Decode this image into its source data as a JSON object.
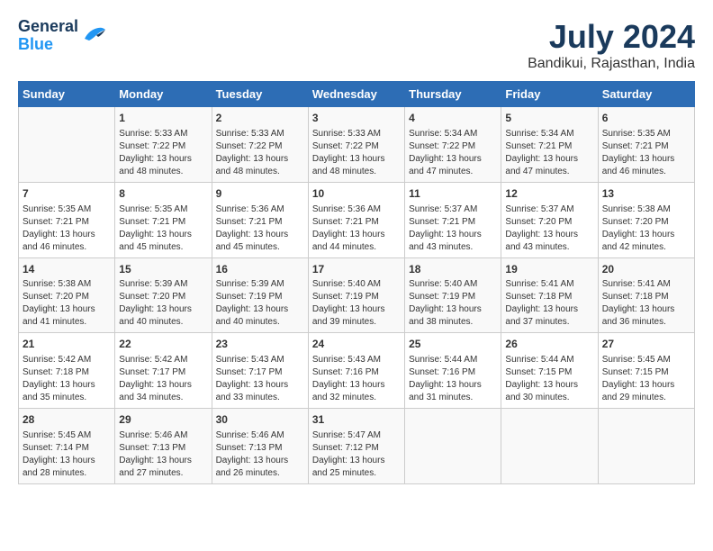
{
  "header": {
    "logo_line1": "General",
    "logo_line2": "Blue",
    "title": "July 2024",
    "subtitle": "Bandikui, Rajasthan, India"
  },
  "days_of_week": [
    "Sunday",
    "Monday",
    "Tuesday",
    "Wednesday",
    "Thursday",
    "Friday",
    "Saturday"
  ],
  "weeks": [
    [
      {
        "day": "",
        "content": ""
      },
      {
        "day": "1",
        "content": "Sunrise: 5:33 AM\nSunset: 7:22 PM\nDaylight: 13 hours\nand 48 minutes."
      },
      {
        "day": "2",
        "content": "Sunrise: 5:33 AM\nSunset: 7:22 PM\nDaylight: 13 hours\nand 48 minutes."
      },
      {
        "day": "3",
        "content": "Sunrise: 5:33 AM\nSunset: 7:22 PM\nDaylight: 13 hours\nand 48 minutes."
      },
      {
        "day": "4",
        "content": "Sunrise: 5:34 AM\nSunset: 7:22 PM\nDaylight: 13 hours\nand 47 minutes."
      },
      {
        "day": "5",
        "content": "Sunrise: 5:34 AM\nSunset: 7:21 PM\nDaylight: 13 hours\nand 47 minutes."
      },
      {
        "day": "6",
        "content": "Sunrise: 5:35 AM\nSunset: 7:21 PM\nDaylight: 13 hours\nand 46 minutes."
      }
    ],
    [
      {
        "day": "7",
        "content": "Sunrise: 5:35 AM\nSunset: 7:21 PM\nDaylight: 13 hours\nand 46 minutes."
      },
      {
        "day": "8",
        "content": "Sunrise: 5:35 AM\nSunset: 7:21 PM\nDaylight: 13 hours\nand 45 minutes."
      },
      {
        "day": "9",
        "content": "Sunrise: 5:36 AM\nSunset: 7:21 PM\nDaylight: 13 hours\nand 45 minutes."
      },
      {
        "day": "10",
        "content": "Sunrise: 5:36 AM\nSunset: 7:21 PM\nDaylight: 13 hours\nand 44 minutes."
      },
      {
        "day": "11",
        "content": "Sunrise: 5:37 AM\nSunset: 7:21 PM\nDaylight: 13 hours\nand 43 minutes."
      },
      {
        "day": "12",
        "content": "Sunrise: 5:37 AM\nSunset: 7:20 PM\nDaylight: 13 hours\nand 43 minutes."
      },
      {
        "day": "13",
        "content": "Sunrise: 5:38 AM\nSunset: 7:20 PM\nDaylight: 13 hours\nand 42 minutes."
      }
    ],
    [
      {
        "day": "14",
        "content": "Sunrise: 5:38 AM\nSunset: 7:20 PM\nDaylight: 13 hours\nand 41 minutes."
      },
      {
        "day": "15",
        "content": "Sunrise: 5:39 AM\nSunset: 7:20 PM\nDaylight: 13 hours\nand 40 minutes."
      },
      {
        "day": "16",
        "content": "Sunrise: 5:39 AM\nSunset: 7:19 PM\nDaylight: 13 hours\nand 40 minutes."
      },
      {
        "day": "17",
        "content": "Sunrise: 5:40 AM\nSunset: 7:19 PM\nDaylight: 13 hours\nand 39 minutes."
      },
      {
        "day": "18",
        "content": "Sunrise: 5:40 AM\nSunset: 7:19 PM\nDaylight: 13 hours\nand 38 minutes."
      },
      {
        "day": "19",
        "content": "Sunrise: 5:41 AM\nSunset: 7:18 PM\nDaylight: 13 hours\nand 37 minutes."
      },
      {
        "day": "20",
        "content": "Sunrise: 5:41 AM\nSunset: 7:18 PM\nDaylight: 13 hours\nand 36 minutes."
      }
    ],
    [
      {
        "day": "21",
        "content": "Sunrise: 5:42 AM\nSunset: 7:18 PM\nDaylight: 13 hours\nand 35 minutes."
      },
      {
        "day": "22",
        "content": "Sunrise: 5:42 AM\nSunset: 7:17 PM\nDaylight: 13 hours\nand 34 minutes."
      },
      {
        "day": "23",
        "content": "Sunrise: 5:43 AM\nSunset: 7:17 PM\nDaylight: 13 hours\nand 33 minutes."
      },
      {
        "day": "24",
        "content": "Sunrise: 5:43 AM\nSunset: 7:16 PM\nDaylight: 13 hours\nand 32 minutes."
      },
      {
        "day": "25",
        "content": "Sunrise: 5:44 AM\nSunset: 7:16 PM\nDaylight: 13 hours\nand 31 minutes."
      },
      {
        "day": "26",
        "content": "Sunrise: 5:44 AM\nSunset: 7:15 PM\nDaylight: 13 hours\nand 30 minutes."
      },
      {
        "day": "27",
        "content": "Sunrise: 5:45 AM\nSunset: 7:15 PM\nDaylight: 13 hours\nand 29 minutes."
      }
    ],
    [
      {
        "day": "28",
        "content": "Sunrise: 5:45 AM\nSunset: 7:14 PM\nDaylight: 13 hours\nand 28 minutes."
      },
      {
        "day": "29",
        "content": "Sunrise: 5:46 AM\nSunset: 7:13 PM\nDaylight: 13 hours\nand 27 minutes."
      },
      {
        "day": "30",
        "content": "Sunrise: 5:46 AM\nSunset: 7:13 PM\nDaylight: 13 hours\nand 26 minutes."
      },
      {
        "day": "31",
        "content": "Sunrise: 5:47 AM\nSunset: 7:12 PM\nDaylight: 13 hours\nand 25 minutes."
      },
      {
        "day": "",
        "content": ""
      },
      {
        "day": "",
        "content": ""
      },
      {
        "day": "",
        "content": ""
      }
    ]
  ]
}
